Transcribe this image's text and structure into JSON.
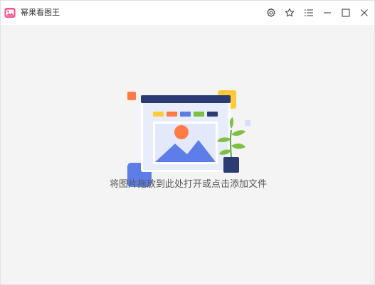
{
  "app": {
    "title": "幂果看图王",
    "logo_icon": "photo-app-logo-icon"
  },
  "titlebar": {
    "buttons": [
      {
        "name": "settings-button",
        "icon": "gear-icon"
      },
      {
        "name": "favorite-button",
        "icon": "star-icon"
      },
      {
        "name": "menu-button",
        "icon": "list-menu-icon"
      },
      {
        "name": "minimize-button",
        "icon": "minimize-icon"
      },
      {
        "name": "maximize-button",
        "icon": "maximize-icon"
      },
      {
        "name": "close-button",
        "icon": "close-icon"
      }
    ]
  },
  "main": {
    "drop_hint": "将图片拖放到此处打开或点击添加文件",
    "illustration_icon": "image-drop-illustration"
  },
  "colors": {
    "accent": "#ff4f8b",
    "illustration_navy": "#2c3b73",
    "illustration_blue": "#5d7ee8",
    "illustration_orange": "#ff7a45",
    "illustration_yellow": "#ffc93c",
    "illustration_green": "#7cc142"
  }
}
